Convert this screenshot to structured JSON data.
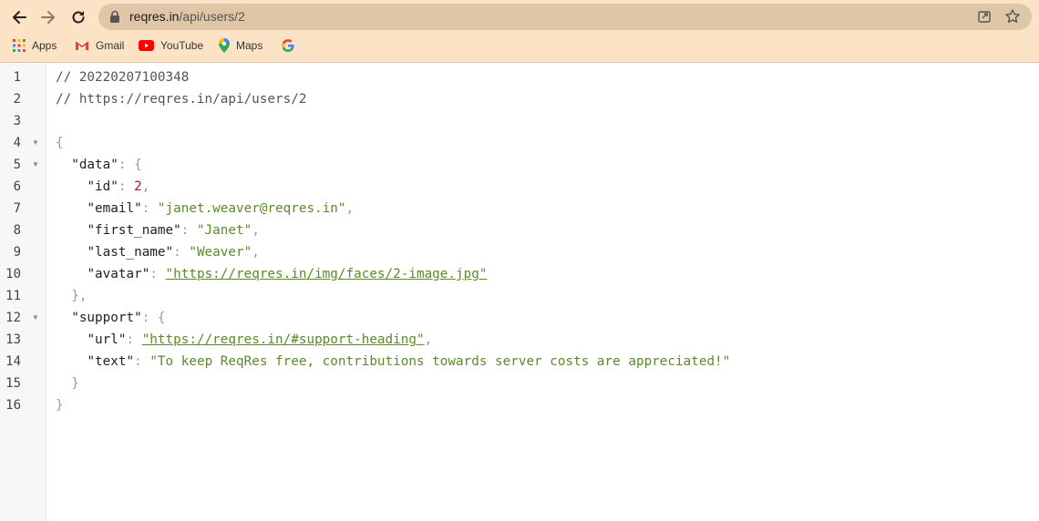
{
  "browser": {
    "url_host": "reqres.in",
    "url_path": "/api/users/2",
    "bookmarks": [
      {
        "label": "Apps",
        "icon": "apps-grid-icon"
      },
      {
        "label": "Gmail",
        "icon": "gmail-icon"
      },
      {
        "label": "YouTube",
        "icon": "youtube-icon"
      },
      {
        "label": "Maps",
        "icon": "maps-icon"
      },
      {
        "label": "",
        "icon": "google-icon"
      }
    ]
  },
  "colors": {
    "chrome_bg": "#fde3c6",
    "omnibox_bg": "#dfc6a6",
    "string": "#5a8a2a",
    "number": "#a0172f"
  },
  "viewer": {
    "line_numbers": [
      "1",
      "2",
      "3",
      "4",
      "5",
      "6",
      "7",
      "8",
      "9",
      "10",
      "11",
      "12",
      "13",
      "14",
      "15",
      "16"
    ],
    "comment_timestamp": "// 20220207100348",
    "comment_url": "// https://reqres.in/api/users/2",
    "json": {
      "data_key": "\"data\"",
      "id_key": "\"id\"",
      "id_value": "2",
      "email_key": "\"email\"",
      "email_value": "\"janet.weaver@reqres.in\"",
      "first_name_key": "\"first_name\"",
      "first_name_value": "\"Janet\"",
      "last_name_key": "\"last_name\"",
      "last_name_value": "\"Weaver\"",
      "avatar_key": "\"avatar\"",
      "avatar_value": "\"https://reqres.in/img/faces/2-image.jpg\"",
      "support_key": "\"support\"",
      "url_key": "\"url\"",
      "url_value": "\"https://reqres.in/#support-heading\"",
      "text_key": "\"text\"",
      "text_value": "\"To keep ReqRes free, contributions towards server costs are appreciated!\""
    }
  }
}
